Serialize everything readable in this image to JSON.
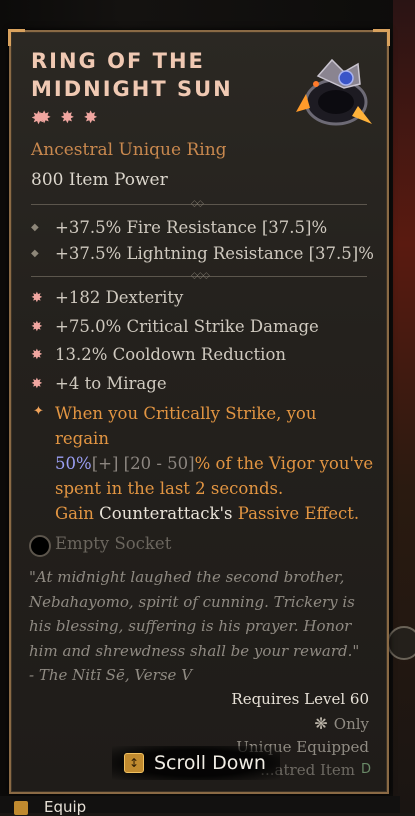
{
  "item": {
    "name": "RING OF THE MIDNIGHT SUN",
    "type_line": "Ancestral Unique Ring",
    "item_power": "800 Item Power"
  },
  "implicits": [
    "+37.5% Fire Resistance [37.5]%",
    "+37.5% Lightning Resistance [37.5]%"
  ],
  "affixes": [
    "+182 Dexterity",
    "+75.0% Critical Strike Damage",
    "13.2% Cooldown Reduction",
    "+4 to Mirage"
  ],
  "unique_power": {
    "line1": "When you Critically Strike, you regain",
    "value": "50%",
    "range_icon": "[+]",
    "range": "[20 - 50]",
    "line2_rest": "% of the Vigor you've",
    "line3": "spent in the last 2 seconds."
  },
  "gain_line": {
    "prefix": "Gain",
    "skill": "Counterattack's",
    "suffix": "Passive Effect."
  },
  "socket": {
    "label": "Empty Socket"
  },
  "flavor_text": "\"At midnight laughed the second brother, Nebahayomo, spirit of cunning. Trickery is his blessing, suffering is his prayer. Honor him and shrewdness shall be your reward.\" - The Nitī Sē, Verse V",
  "requirements": {
    "level": "Requires Level 60",
    "class_icon": "rogue-class-icon",
    "only": "Only",
    "unique_equipped": "Unique Equipped",
    "equipped_item": "...atred Item"
  },
  "scroll_button": {
    "icon_key": "↕",
    "label": "Scroll Down"
  },
  "footer": {
    "equip_label": "Equip"
  },
  "colors": {
    "unique_orange": "#e29542",
    "title_pink": "#f0c9b3",
    "value_blue": "#9a9ef2",
    "frame_gold": "#8a6a45"
  }
}
